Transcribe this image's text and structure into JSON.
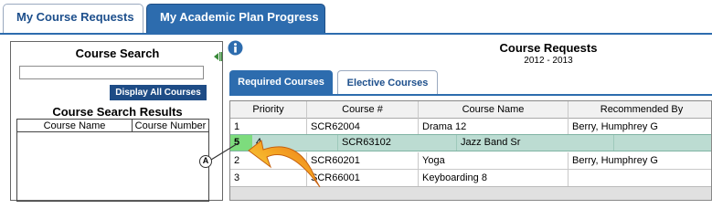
{
  "tabs": {
    "my_course_requests": "My Course Requests",
    "my_academic_plan_progress": "My Academic Plan Progress"
  },
  "search": {
    "title": "Course Search",
    "input_value": "",
    "display_all_label": "Display All Courses",
    "results_title": "Course Search Results",
    "columns": [
      "Course Name",
      "Course Number"
    ]
  },
  "requests": {
    "title": "Course Requests",
    "years": "2012 - 2013",
    "tabs": [
      "Required Courses",
      "Elective Courses"
    ],
    "columns": [
      "Priority",
      "Course #",
      "Course Name",
      "Recommended By"
    ],
    "rows": [
      {
        "priority": "1",
        "course_num": "SCR62004",
        "course_name": "Drama 12",
        "recommended_by": "Berry, Humphrey G"
      },
      {
        "priority": "2",
        "course_num": "SCR60201",
        "course_name": "Yoga",
        "recommended_by": "Berry, Humphrey G"
      },
      {
        "priority": "3",
        "course_num": "SCR66001",
        "course_name": "Keyboarding 8",
        "recommended_by": ""
      }
    ],
    "dragged": {
      "new_priority": "5",
      "priority": "4",
      "course_num": "SCR63102",
      "course_name": "Jazz Band Sr"
    }
  },
  "annotation": {
    "label": "A"
  },
  "colors": {
    "brand_blue": "#2d6cae",
    "button_blue": "#1e4c86",
    "drag_row": "#bcdcd2",
    "drag_priority": "#7ddc7d",
    "arrow_orange": "#f28c1e"
  },
  "icons": {
    "info": "info-icon",
    "collapse": "collapse-panel-icon",
    "arrow": "curved-arrow-icon"
  }
}
